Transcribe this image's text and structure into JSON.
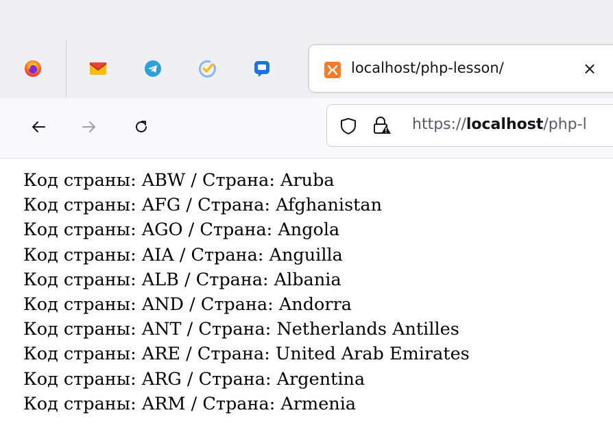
{
  "pinned_tabs": [
    {
      "icon": "firefox-icon"
    },
    {
      "icon": "gmail-icon",
      "color": "#ea4335"
    },
    {
      "icon": "telegram-icon",
      "color": "#2aa1da"
    },
    {
      "icon": "tasks-check-icon",
      "color": "#3f6ae0"
    },
    {
      "icon": "chat-bubble-icon",
      "color": "#1a73e8"
    }
  ],
  "tab": {
    "title": "localhost/php-lesson/",
    "close_label": "×",
    "favicon_color": "#fb7a24"
  },
  "urlbar": {
    "scheme": "https://",
    "host": "localhost",
    "path": "/php-l"
  },
  "content": {
    "code_label": "Код страны:",
    "country_label": "Страна:",
    "rows": [
      {
        "code": "ABW",
        "name": "Aruba"
      },
      {
        "code": "AFG",
        "name": "Afghanistan"
      },
      {
        "code": "AGO",
        "name": "Angola"
      },
      {
        "code": "AIA",
        "name": "Anguilla"
      },
      {
        "code": "ALB",
        "name": "Albania"
      },
      {
        "code": "AND",
        "name": "Andorra"
      },
      {
        "code": "ANT",
        "name": "Netherlands Antilles"
      },
      {
        "code": "ARE",
        "name": "United Arab Emirates"
      },
      {
        "code": "ARG",
        "name": "Argentina"
      },
      {
        "code": "ARM",
        "name": "Armenia"
      }
    ]
  },
  "colors": {
    "accent": "#0061e0",
    "tabstrip_bg": "#f0f0f4",
    "navbar_bg": "#f9f9fb"
  }
}
